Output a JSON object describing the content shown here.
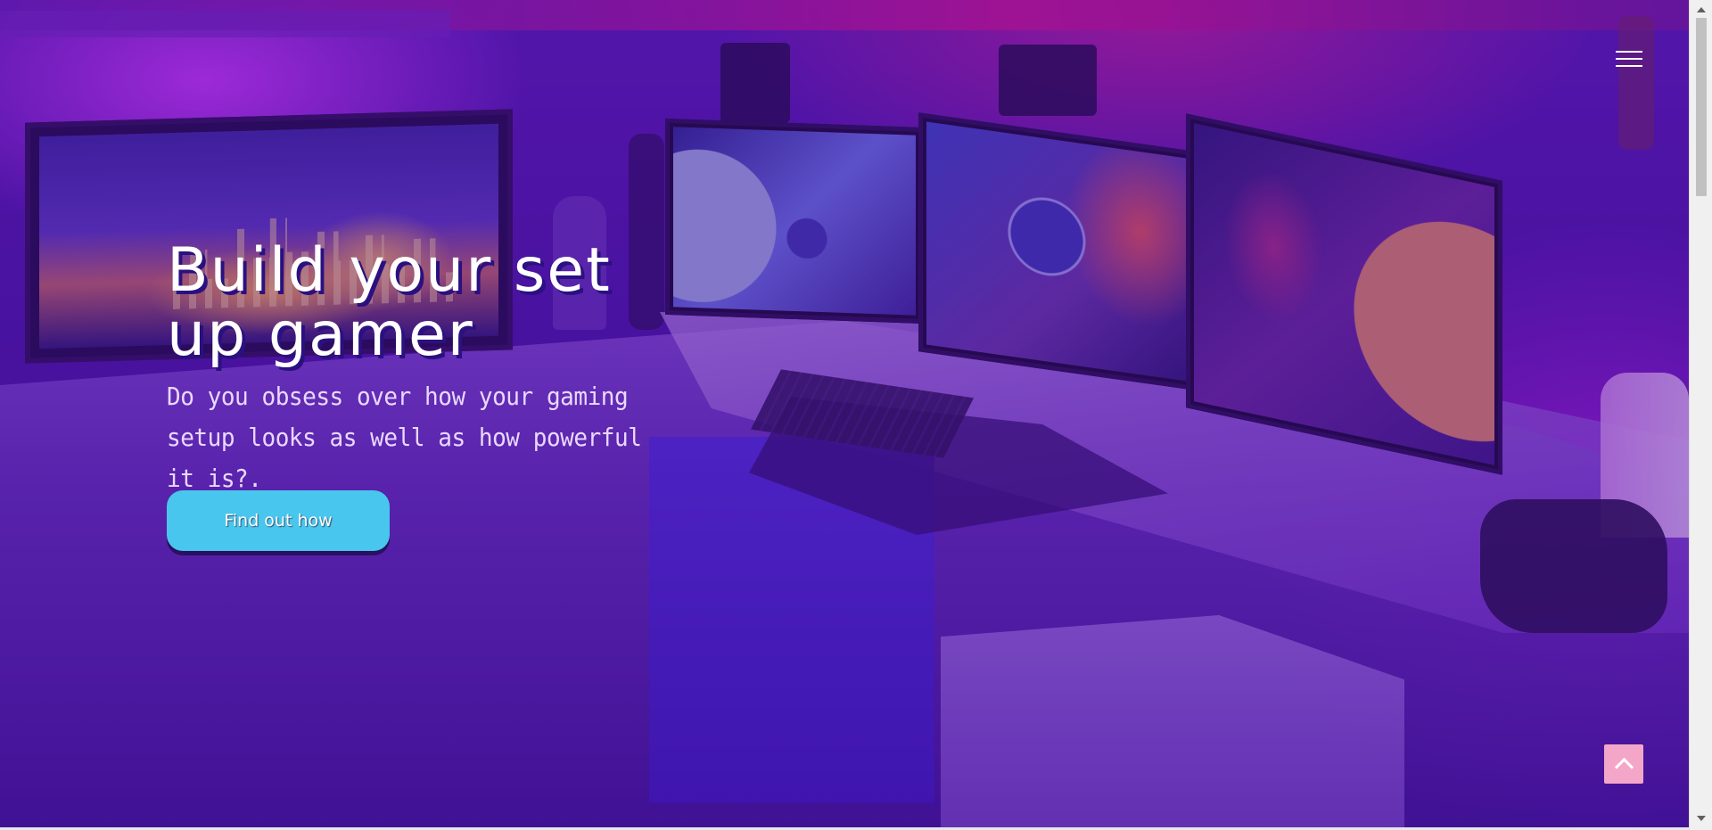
{
  "nav": {
    "menu_icon": "hamburger-menu-icon"
  },
  "hero": {
    "title_line1": "Build your set",
    "title_line2": "up gamer",
    "subtitle": "Do you obsess over how your gaming setup looks as well as how powerful it is?.",
    "cta_label": "Find out how"
  },
  "scroll_top": {
    "icon": "chevron-up-icon"
  },
  "colors": {
    "cta_background": "#48c6ee",
    "scroll_top_background": "#f4a6c8",
    "overlay": "#460c96"
  }
}
